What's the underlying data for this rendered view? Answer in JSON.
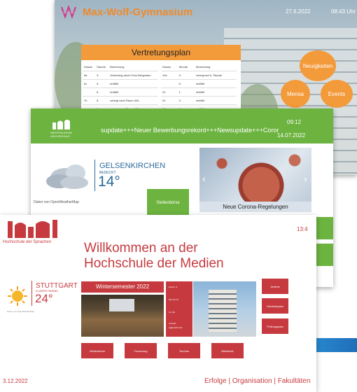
{
  "screen1": {
    "title": "Max-Wolf-Gymnasium",
    "date": "27.6.2022",
    "time": "08:43 Uhr",
    "plan_title": "Vertretungsplan",
    "table_left": {
      "headers": [
        "Klasse",
        "Stunde",
        "Bemerkung"
      ],
      "rows": [
        [
          "5a",
          "3.",
          "Vertretung durch Frau Bergmann"
        ],
        [
          "6c",
          "5.",
          "entfällt"
        ],
        [
          "",
          "6.",
          "entfällt"
        ],
        [
          "7b",
          "8.",
          "verlegt nach Raum 404"
        ],
        [
          "",
          "9.",
          "verlegt nach Raum 404"
        ]
      ]
    },
    "table_right": {
      "headers": [
        "Klasse",
        "Stunde",
        "Bemerkung"
      ],
      "rows": [
        [
          "10e",
          "3.",
          "verlegt auf 6. Stunde"
        ],
        [
          "",
          "6.",
          "entfällt"
        ],
        [
          "K1",
          "1.",
          "entfällt"
        ],
        [
          "K1",
          "3.",
          "entfällt"
        ],
        [
          "K1",
          "6.",
          "entfällt"
        ]
      ]
    },
    "bubbles": {
      "news": "Neuigkeiten",
      "mensa": "Mensa",
      "events": "Events"
    },
    "colors": {
      "accent": "#f39a3a"
    }
  },
  "screen2": {
    "logo_text": "WESTFÄLISCHE HOCHSCHULE",
    "ticker": "supdate+++Neuer Bewerbungsrekord+++Newsupdate+++Coror",
    "clock": "09:12",
    "date": "14.07.2022",
    "weather": {
      "city": "GELSENKIRCHEN",
      "condition": "BEDECKT",
      "temp": "14°",
      "source": "Daten von OpenWeatherMap"
    },
    "button": "Stellenbörse",
    "news_caption": "Neue Corona-Regelungen",
    "colors": {
      "accent": "#6cb33f"
    }
  },
  "screen3": {
    "school": "Hochschule der Sprachen",
    "clock": "13:4",
    "welcome_line1": "Willkommen an der",
    "welcome_line2": "Hochschule der Medien",
    "weather": {
      "city": "STUTTGART",
      "condition": "KLARER HIMMEL",
      "temp": "24°",
      "source": "Daten von OpenWeatherMap"
    },
    "semester": "Wintersemester 2022",
    "info": {
      "line1": "Gesch. 4",
      "line2": "Zimmer Nr.",
      "line3": "zur HS",
      "line4": "Kontakt",
      "line5": "sg@mailno.de"
    },
    "right_buttons": [
      "Vereine",
      "Gebäudeplan",
      "Prüfungsplan"
    ],
    "bottom_buttons": [
      "Stellenbörse",
      "Forschung",
      "Termine",
      "Bibliothek"
    ],
    "footer_date": "3.12.2022",
    "footer_nav": "Erfolge | Organisation | Fakultäten",
    "colors": {
      "accent": "#c63a3f"
    }
  }
}
